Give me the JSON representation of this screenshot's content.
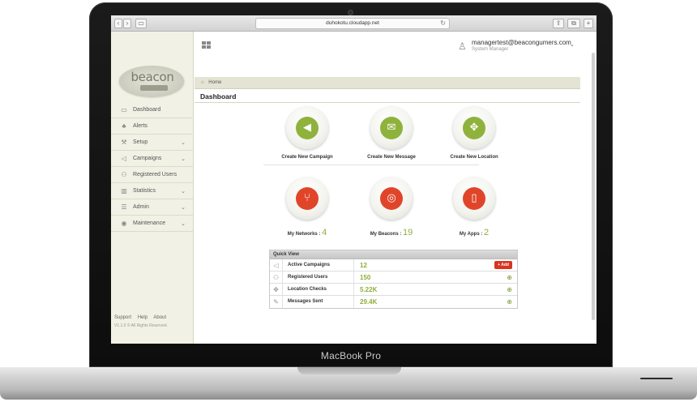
{
  "device": {
    "brand_label": "MacBook Pro"
  },
  "browser": {
    "url": "duhokotu.cloudapp.net",
    "back_icon": "chevron-left-icon",
    "forward_icon": "chevron-right-icon"
  },
  "logo": {
    "text": "beacon"
  },
  "sidebar": {
    "items": [
      {
        "label": "Dashboard",
        "icon": "monitor-icon",
        "has_chevron": false
      },
      {
        "label": "Alerts",
        "icon": "bell-icon",
        "has_chevron": false
      },
      {
        "label": "Setup",
        "icon": "wrench-icon",
        "has_chevron": true
      },
      {
        "label": "Campaigns",
        "icon": "megaphone-icon",
        "has_chevron": true
      },
      {
        "label": "Registered Users",
        "icon": "users-icon",
        "has_chevron": false
      },
      {
        "label": "Statistics",
        "icon": "bar-chart-icon",
        "has_chevron": true
      },
      {
        "label": "Admin",
        "icon": "list-icon",
        "has_chevron": true
      },
      {
        "label": "Maintenance",
        "icon": "eye-icon",
        "has_chevron": true
      }
    ],
    "footer": {
      "links": [
        "Support",
        "Help",
        "About"
      ],
      "copyright": "V1.1.0 © All Rights Reserved."
    }
  },
  "header": {
    "user_email": "managertest@beacongumers.com",
    "user_role": "System Manager"
  },
  "breadcrumb": {
    "home": "Home"
  },
  "page": {
    "title": "Dashboard"
  },
  "tiles": {
    "create": [
      {
        "label": "Create New Campaign",
        "icon": "megaphone-icon",
        "color": "#8fb23c"
      },
      {
        "label": "Create New Message",
        "icon": "envelope-icon",
        "color": "#8fb23c"
      },
      {
        "label": "Create New Location",
        "icon": "crosshair-icon",
        "color": "#8fb23c"
      }
    ],
    "counts": [
      {
        "label": "My Networks :",
        "count": "4",
        "icon": "network-icon",
        "color": "#e0452a"
      },
      {
        "label": "My Beacons :",
        "count": "19",
        "icon": "target-icon",
        "color": "#e0452a"
      },
      {
        "label": "My Apps :",
        "count": "2",
        "icon": "mobile-icon",
        "color": "#e0452a"
      }
    ]
  },
  "quick_view": {
    "title": "Quick View",
    "rows": [
      {
        "icon": "megaphone-icon",
        "label": "Active Campaigns",
        "value": "12",
        "action": "add",
        "action_label": "+ Add"
      },
      {
        "icon": "users-icon",
        "label": "Registered Users",
        "value": "150",
        "action": "zoom"
      },
      {
        "icon": "crosshair-icon",
        "label": "Location Checks",
        "value": "5.22K",
        "action": "zoom"
      },
      {
        "icon": "edit-icon",
        "label": "Messages Sent",
        "value": "29.4K",
        "action": "zoom"
      }
    ]
  },
  "colors": {
    "accent_green": "#8fae3a",
    "accent_red": "#e0452a",
    "add_button": "#d8341e"
  }
}
